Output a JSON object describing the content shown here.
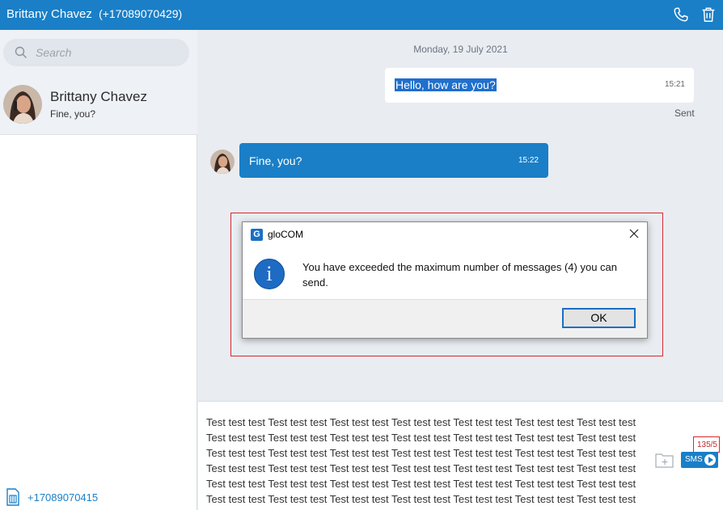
{
  "header": {
    "contact_name": "Brittany Chavez",
    "contact_phone": "(+17089070429)",
    "call_icon": "phone-icon",
    "delete_icon": "trash-icon"
  },
  "sidebar": {
    "search_placeholder": "Search",
    "conversations": [
      {
        "name": "Brittany Chavez",
        "last_message": "Fine, you?"
      }
    ],
    "own_number": "+17089070415"
  },
  "chat": {
    "date_separator": "Monday, 19 July 2021",
    "messages": [
      {
        "direction": "outgoing",
        "text": "Hello, how are you?",
        "time": "15:21",
        "status": "Sent"
      },
      {
        "direction": "incoming",
        "text": "Fine, you?",
        "time": "15:22"
      }
    ]
  },
  "dialog": {
    "title": "gloCOM",
    "logo_letter": "G",
    "message": "You have exceeded the maximum number of messages (4) you can send.",
    "ok_label": "OK",
    "icon": "info-icon"
  },
  "composer": {
    "text": "Test test test Test test test Test test test Test test test Test test test Test test test Test test test Test test test Test test test Test test test Test test test Test test test Test test test Test test test Test test test Test test test Test test test Test test test Test test test Test test test Test test test Test test test Test test test Test test test Test test test Test test test Test test test Test test test Test test test Test test test Test test test Test test test Test test test Test test test Test test test Test test test Test test test Test test test Test test test Test test test Test test test Test test test",
    "char_counter": "135/5",
    "send_label": "SMS"
  },
  "colors": {
    "brand": "#1a7fc7",
    "highlight_border": "#d9262e"
  }
}
